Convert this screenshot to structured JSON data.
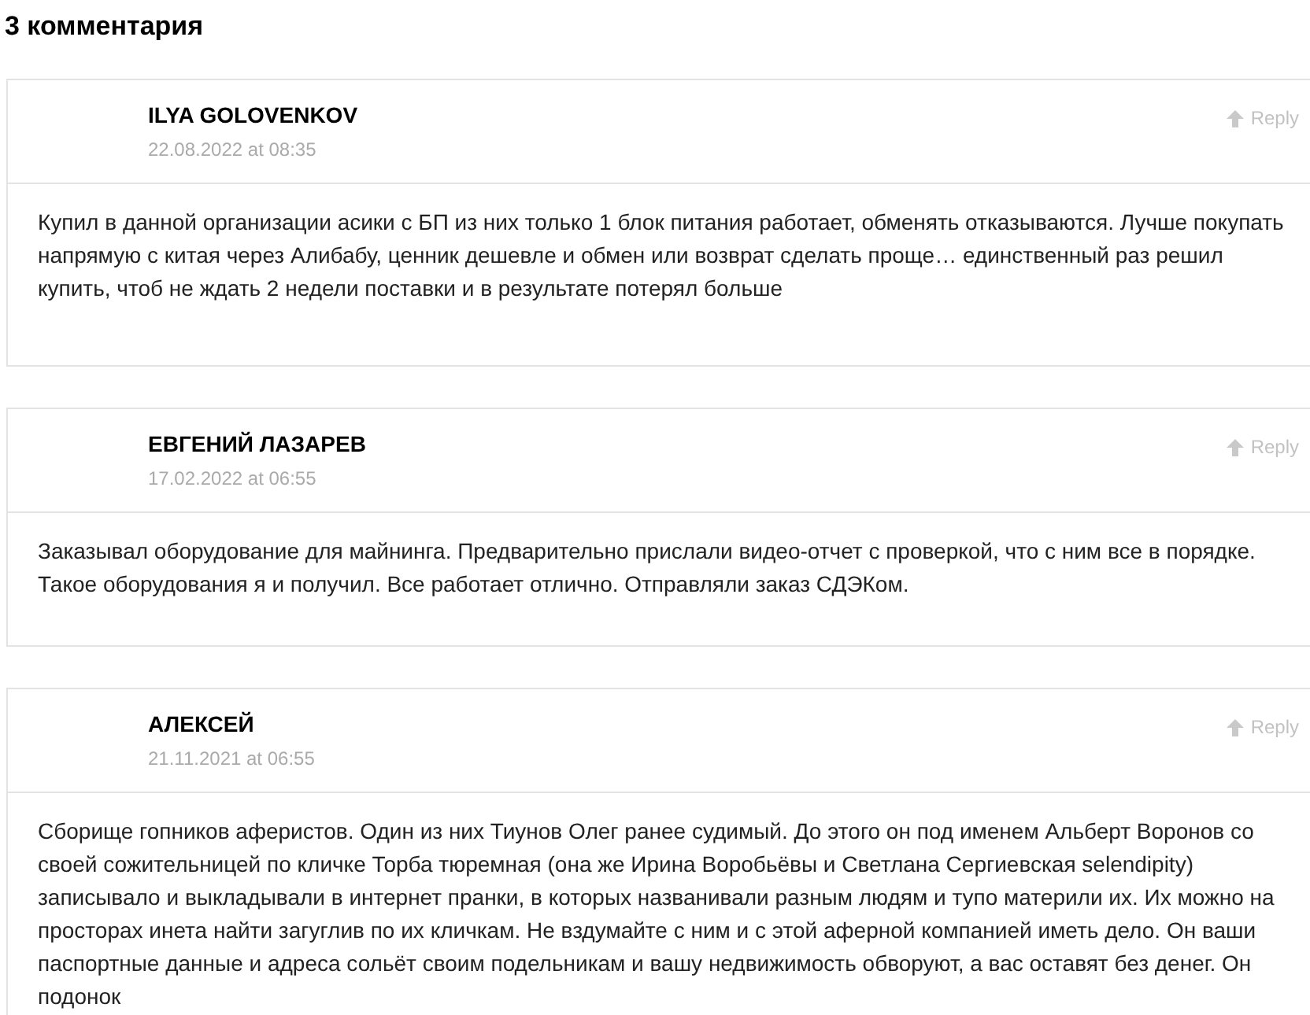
{
  "heading": "3 комментария",
  "comments": [
    {
      "author": "ILYA GOLOVENKOV",
      "date": "22.08.2022 at 08:35",
      "reply": "Reply",
      "text": "Купил в данной организации асики с БП из них только 1 блок питания работает, обменять отказываются. Лучше покупать напрямую с китая через Алибабу, ценник дешевле и обмен или возврат сделать проще… единственный раз решил купить, чтоб не ждать 2 недели поставки и в результате потерял больше"
    },
    {
      "author": "ЕВГЕНИЙ ЛАЗАРЕВ",
      "date": "17.02.2022 at 06:55",
      "reply": "Reply",
      "text": "Заказывал оборудование для майнинга. Предварительно прислали видео-отчет с проверкой, что с ним все в порядке. Такое оборудования я и получил. Все работает отлично. Отправляли заказ СДЭКом."
    },
    {
      "author": "АЛЕКСЕЙ",
      "date": "21.11.2021 at 06:55",
      "reply": "Reply",
      "text": "Сборище гопников аферистов. Один из них Тиунов Олег ранее судимый. До этого он под именем Альберт Воронов со своей сожительницей по кличке Торба тюремная (она же Ирина Воробьёвы и Светлана Сергиевская selendipity) записывало и выкладывали в интернет пранки, в которых названивали разным людям и тупо материли их. Их можно на просторах инета найти загуглив по их кличкам. Не вздумайте с ним и с этой аферной компанией иметь дело. Он ваши паспортные данные и адреса сольёт своим подельникам и вашу недвижимость обворуют, а вас оставят без денег. Он подонок"
    }
  ]
}
